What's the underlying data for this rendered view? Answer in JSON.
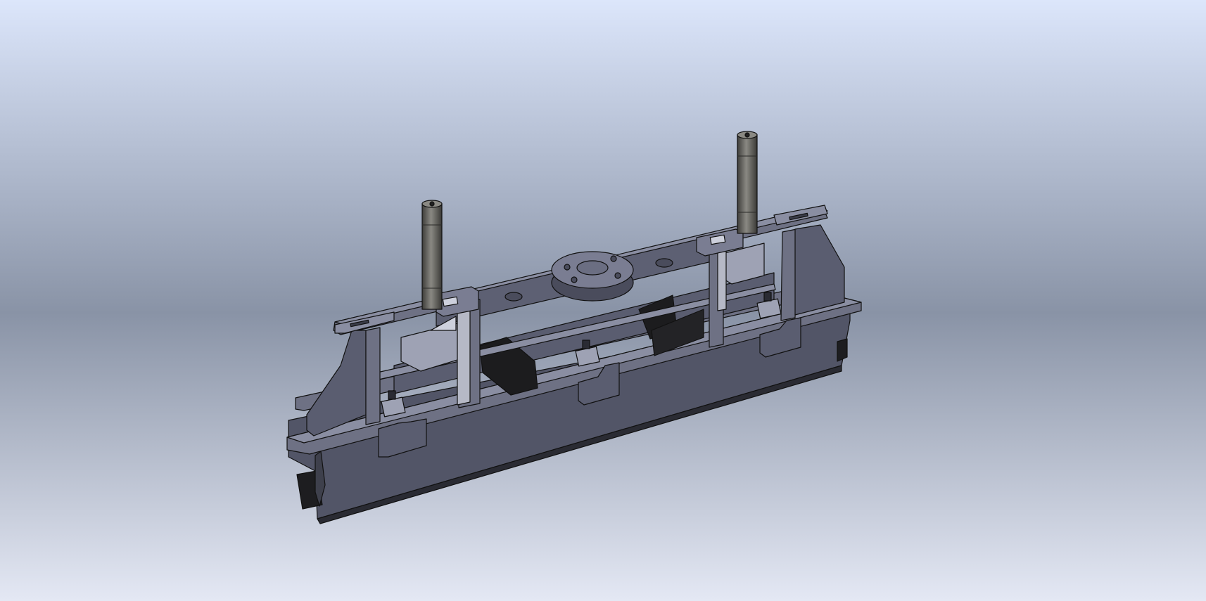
{
  "viewport": {
    "background_top": "#dce6fb",
    "background_mid": "#8993a6",
    "background_bottom": "#e4e8f4"
  },
  "model": {
    "body_color": "#525567",
    "face_light": "#6e7184",
    "face_top": "#8a8ea2",
    "dark_part": "#1c1c1e",
    "rod_color": "#5b5a55",
    "edge_color": "#111111"
  }
}
